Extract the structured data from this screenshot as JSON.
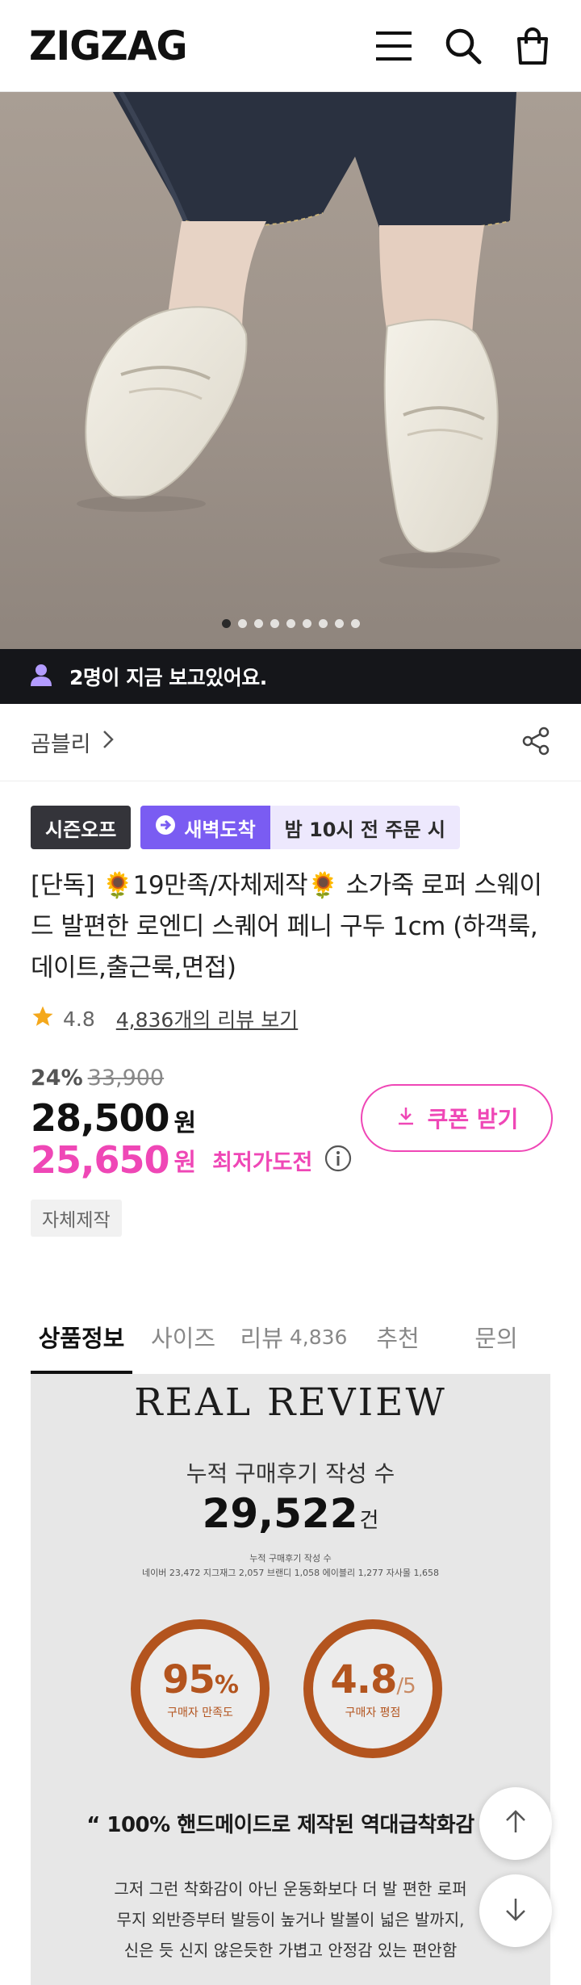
{
  "header": {
    "logo": "ZIGZAG",
    "icons": [
      "menu-icon",
      "search-icon",
      "shopping-bag-icon"
    ]
  },
  "hero": {
    "image_description": "product photo",
    "carousel": {
      "total": 9,
      "active_index": 0
    }
  },
  "viewers": {
    "text": "2명이 지금 보고있어요."
  },
  "store": {
    "name": "곰블리",
    "share_icon": "share-icon"
  },
  "badges": {
    "season": "시즌오프",
    "dawn": "새벽도착",
    "order_note": "밤 10시 전 주문 시"
  },
  "product": {
    "title": "[단독] 🌻19만족/자체제작🌻 소가죽 로퍼 스웨이드 발편한 로엔디 스퀘어 페니 구두 1cm (하객룩,데이트,출근룩,면접)",
    "rating": "4.8",
    "review_link": "4,836개의 리뷰 보기",
    "discount": "24%",
    "original_price": "33,900",
    "price": "28,500",
    "price_unit": "원",
    "final_price": "25,650",
    "final_unit": "원",
    "final_label": "최저가도전",
    "coupon_label": "쿠폰 받기",
    "tag": "자체제작"
  },
  "tabs": [
    {
      "label": "상품정보",
      "count": ""
    },
    {
      "label": "사이즈",
      "count": ""
    },
    {
      "label": "리뷰",
      "count": "4,836"
    },
    {
      "label": "추천",
      "count": ""
    },
    {
      "label": "문의",
      "count": ""
    }
  ],
  "review_panel": {
    "heading": "REAL REVIEW",
    "cumulative_label": "누적 구매후기 작성 수",
    "cumulative_count": "29,522",
    "cumulative_unit": "건",
    "small_label": "누적 구매후기 작성 수",
    "breakdown": "네이버 23,472 지그재그 2,057 브랜디 1,058 에이블리 1,277 자사몰 1,658",
    "satisfaction_value": "95",
    "satisfaction_unit": "%",
    "satisfaction_label": "구매자 만족도",
    "score_value": "4.8",
    "score_suffix": "/5",
    "score_label": "구매자 평점",
    "quote": "“ 100% 핸드메이드로 제작된 역대급착화감 ”",
    "description": [
      "그저 그런 착화감이 아닌 운동화보다 더 발 편한 로퍼",
      "무지 외반증부터 발등이 높거나 발볼이 넓은 발까지,",
      "신은 듯 신지 않은듯한 가볍고 안정감 있는 편안함"
    ]
  },
  "colors": {
    "accent_pink": "#ef47b6",
    "accent_purple": "#7a5cf2",
    "ring_brown": "#b3541e"
  }
}
